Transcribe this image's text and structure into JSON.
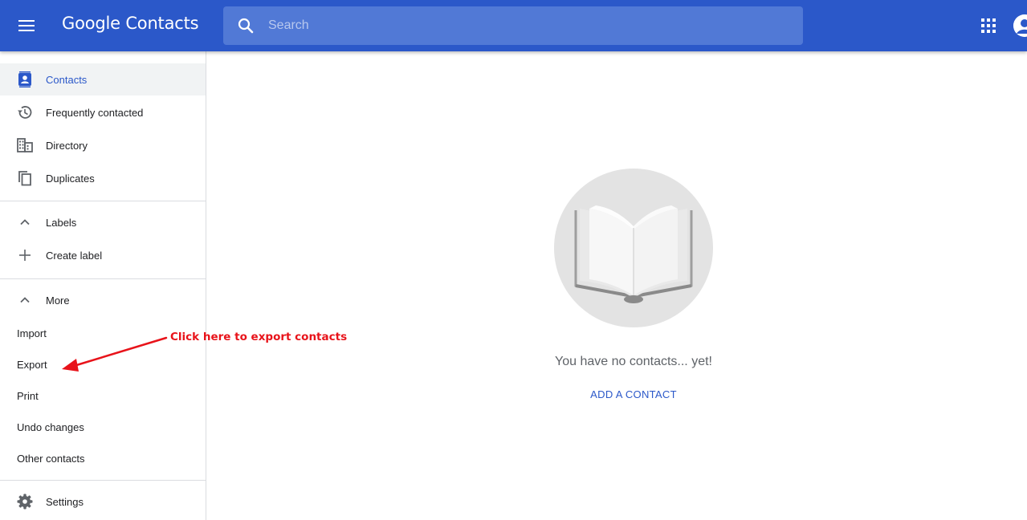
{
  "header": {
    "app_title": "Google Contacts",
    "search_placeholder": "Search",
    "brand_color": "#2b58c9"
  },
  "sidebar": {
    "nav": [
      {
        "label": "Contacts",
        "icon": "contacts-icon",
        "active": true
      },
      {
        "label": "Frequently contacted",
        "icon": "history-icon"
      },
      {
        "label": "Directory",
        "icon": "domain-icon"
      },
      {
        "label": "Duplicates",
        "icon": "copy-icon"
      }
    ],
    "labels_section": {
      "label": "Labels",
      "icon": "chevron-up-icon"
    },
    "create_label": {
      "label": "Create label",
      "icon": "plus-icon"
    },
    "more_section": {
      "label": "More",
      "icon": "chevron-up-icon"
    },
    "more_items": [
      "Import",
      "Export",
      "Print",
      "Undo changes",
      "Other contacts"
    ],
    "settings": {
      "label": "Settings",
      "icon": "gear-icon"
    }
  },
  "main": {
    "empty_message": "You have no contacts... yet!",
    "add_contact_label": "ADD A CONTACT"
  },
  "annotation": {
    "text": "Click here to export contacts",
    "color": "#e8131a"
  }
}
